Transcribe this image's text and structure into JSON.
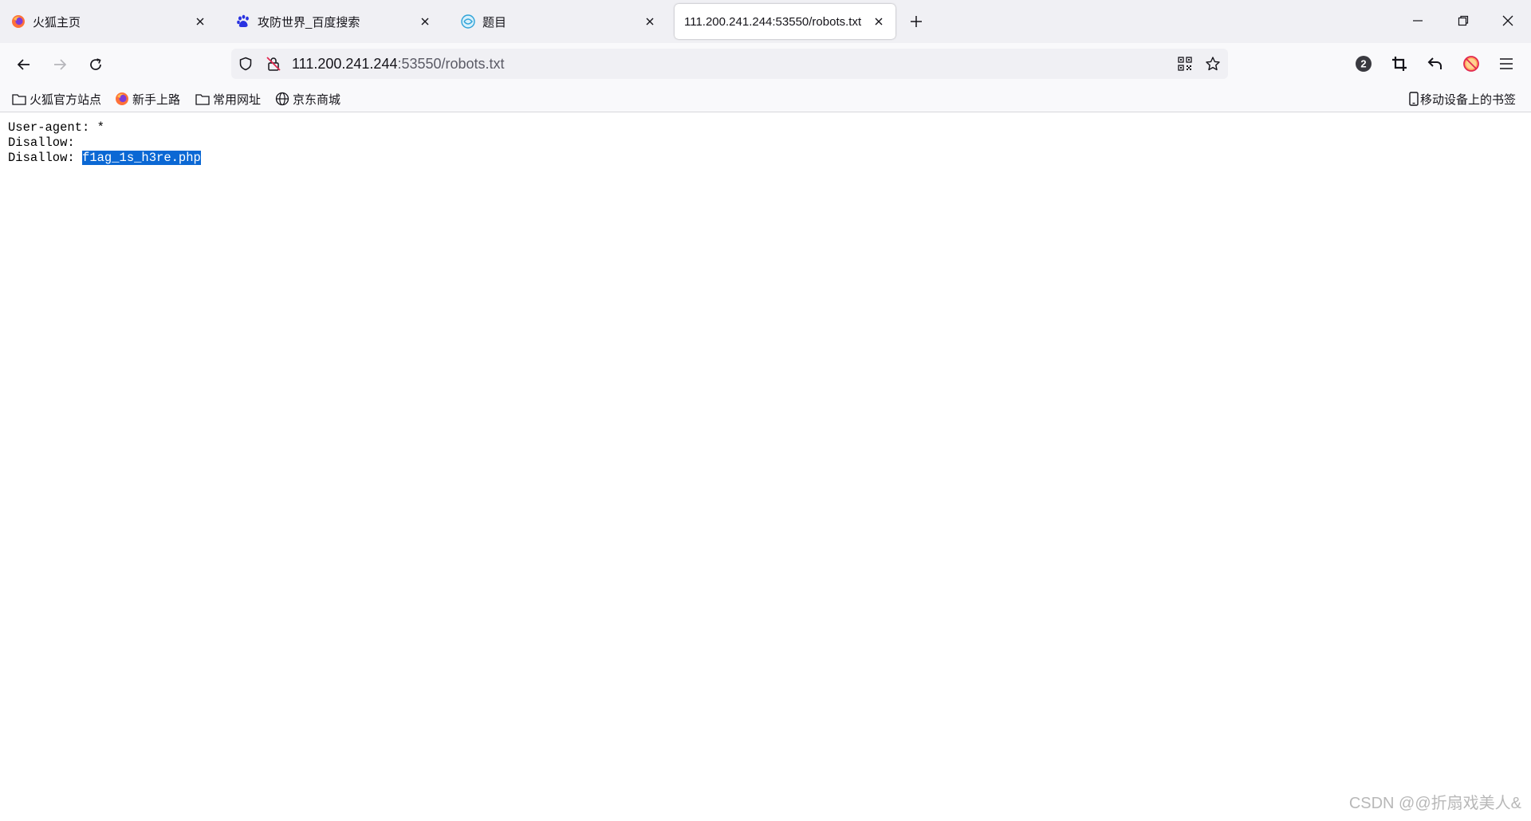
{
  "tabs": [
    {
      "title": "火狐主页",
      "favicon": "firefox-icon"
    },
    {
      "title": "攻防世界_百度搜索",
      "favicon": "baidu-paw-icon"
    },
    {
      "title": "题目",
      "favicon": "globe-swirl-icon"
    },
    {
      "title": "111.200.241.244:53550/robots.txt",
      "active": true
    }
  ],
  "address_bar": {
    "host": "111.200.241.244",
    "path": ":53550/robots.txt"
  },
  "bookmarks": [
    {
      "label": "火狐官方站点",
      "icon": "folder-icon"
    },
    {
      "label": "新手上路",
      "icon": "firefox-icon"
    },
    {
      "label": "常用网址",
      "icon": "folder-icon"
    },
    {
      "label": "京东商城",
      "icon": "globe-icon"
    }
  ],
  "mobile_bookmarks": "移动设备上的书签",
  "toolbar": {
    "badge_count": "2"
  },
  "content": {
    "line1": "User-agent: *",
    "line2": "Disallow:",
    "line3_prefix": "Disallow: ",
    "line3_selected": "f1ag_1s_h3re.php"
  },
  "watermark": "CSDN @@折扇戏美人&",
  "colors": {
    "selection": "#0b68d4",
    "tabbar_bg": "#f0f0f4",
    "toolbar_bg": "#f9f9fb"
  }
}
